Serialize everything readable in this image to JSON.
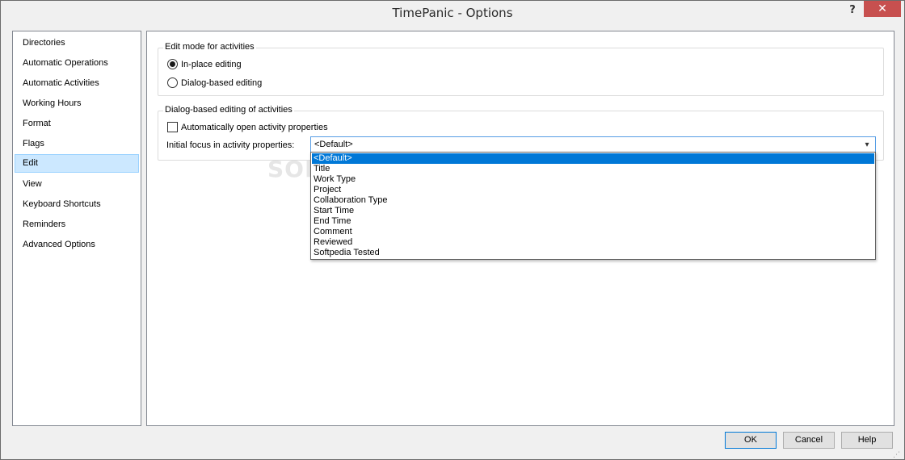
{
  "window": {
    "title": "TimePanic - Options",
    "help_label": "?",
    "close_label": "✕"
  },
  "sidebar": {
    "items": [
      {
        "label": "Directories"
      },
      {
        "label": "Automatic Operations"
      },
      {
        "label": "Automatic Activities"
      },
      {
        "label": "Working Hours"
      },
      {
        "label": "Format"
      },
      {
        "label": "Flags"
      },
      {
        "label": "Edit",
        "selected": true
      },
      {
        "label": "View"
      },
      {
        "label": "Keyboard Shortcuts"
      },
      {
        "label": "Reminders"
      },
      {
        "label": "Advanced Options"
      }
    ]
  },
  "edit_mode": {
    "caption": "Edit mode for activities",
    "options": [
      {
        "label": "In-place editing",
        "checked": true
      },
      {
        "label": "Dialog-based editing",
        "checked": false
      }
    ]
  },
  "dialog_editing": {
    "caption": "Dialog-based editing of activities",
    "auto_open_label": "Automatically open activity properties",
    "auto_open_checked": false,
    "focus_label": "Initial focus in activity properties:",
    "focus_value": "<Default>",
    "focus_options": [
      "<Default>",
      "Title",
      "Work Type",
      "Project",
      "Collaboration Type",
      "Start Time",
      "End Time",
      "Comment",
      "Reviewed",
      "Softpedia Tested"
    ]
  },
  "watermark": "SOFTPEDIA",
  "buttons": {
    "ok": "OK",
    "cancel": "Cancel",
    "help": "Help"
  },
  "colors": {
    "selection": "#0078d7",
    "nav_selection": "#cce8ff",
    "close_button": "#c7504f"
  }
}
